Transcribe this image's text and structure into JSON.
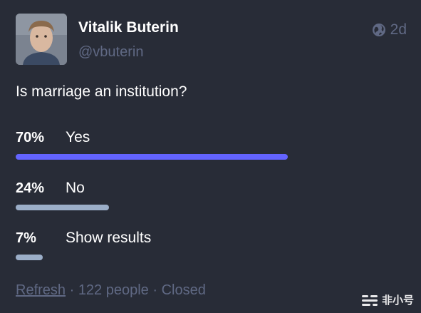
{
  "author": {
    "display_name": "Vitalik Buterin",
    "handle": "@vbuterin"
  },
  "meta": {
    "visibility_icon": "globe-icon",
    "relative_time": "2d"
  },
  "poll": {
    "question": "Is marriage an institution?",
    "options": [
      {
        "percent_label": "70%",
        "label": "Yes",
        "share": 0.7,
        "leading": true
      },
      {
        "percent_label": "24%",
        "label": "No",
        "share": 0.24,
        "leading": false
      },
      {
        "percent_label": "7%",
        "label": "Show results",
        "share": 0.07,
        "leading": false
      }
    ],
    "footer": {
      "refresh_label": "Refresh",
      "separator": " · ",
      "people_count": "122 people",
      "status": "Closed"
    }
  },
  "watermark": {
    "text": "非小号"
  },
  "colors": {
    "background": "#282c37",
    "leading_bar": "#6364ff",
    "bar": "#9baec8",
    "muted_text": "#606984"
  }
}
